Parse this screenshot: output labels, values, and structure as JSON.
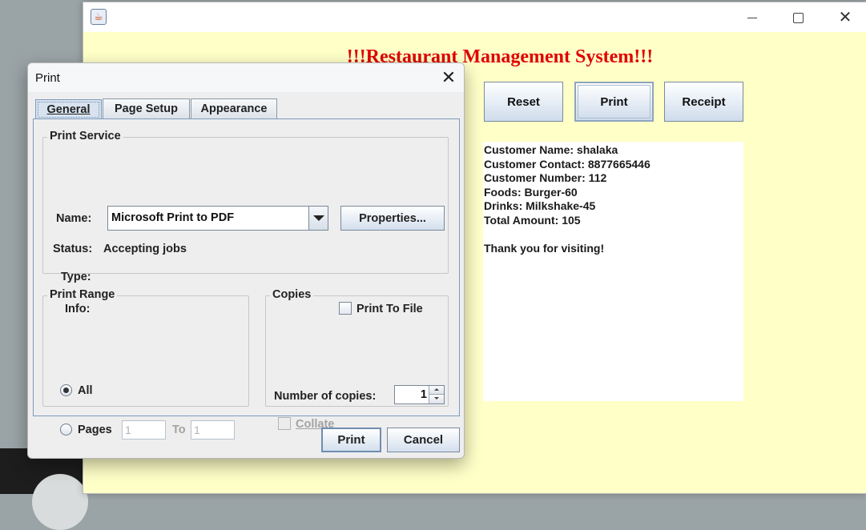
{
  "main_window": {
    "title": "!!!Restaurant Management System!!!",
    "buttons": {
      "reset": "Reset",
      "print": "Print",
      "receipt": "Receipt"
    },
    "receipt_lines": [
      "Customer Name: shalaka",
      "Customer Contact: 8877665446",
      "Customer Number: 112",
      "Foods: Burger-60",
      "Drinks: Milkshake-45",
      "Total Amount: 105",
      "",
      "Thank you for visiting!"
    ]
  },
  "print_dialog": {
    "title": "Print",
    "tabs": {
      "general": "General",
      "page_setup": "Page Setup",
      "appearance": "Appearance"
    },
    "print_service": {
      "group_label": "Print Service",
      "name_label": "Name:",
      "printer": "Microsoft Print to PDF",
      "properties_button": "Properties...",
      "status_label": "Status:",
      "status_value": "Accepting jobs",
      "type_label": "Type:",
      "info_label": "Info:",
      "print_to_file": "Print To File",
      "print_to_file_checked": false
    },
    "print_range": {
      "group_label": "Print Range",
      "all": "All",
      "all_selected": true,
      "pages": "Pages",
      "from": "1",
      "to_label": "To",
      "to": "1"
    },
    "copies": {
      "group_label": "Copies",
      "number_label": "Number of copies:",
      "value": "1",
      "collate": "Collate",
      "collate_enabled": false
    },
    "buttons": {
      "print": "Print",
      "cancel": "Cancel"
    }
  },
  "icons": {
    "app": "java-app-icon",
    "minimize": "minimize-icon",
    "maximize": "maximize-icon",
    "close": "close-icon"
  }
}
